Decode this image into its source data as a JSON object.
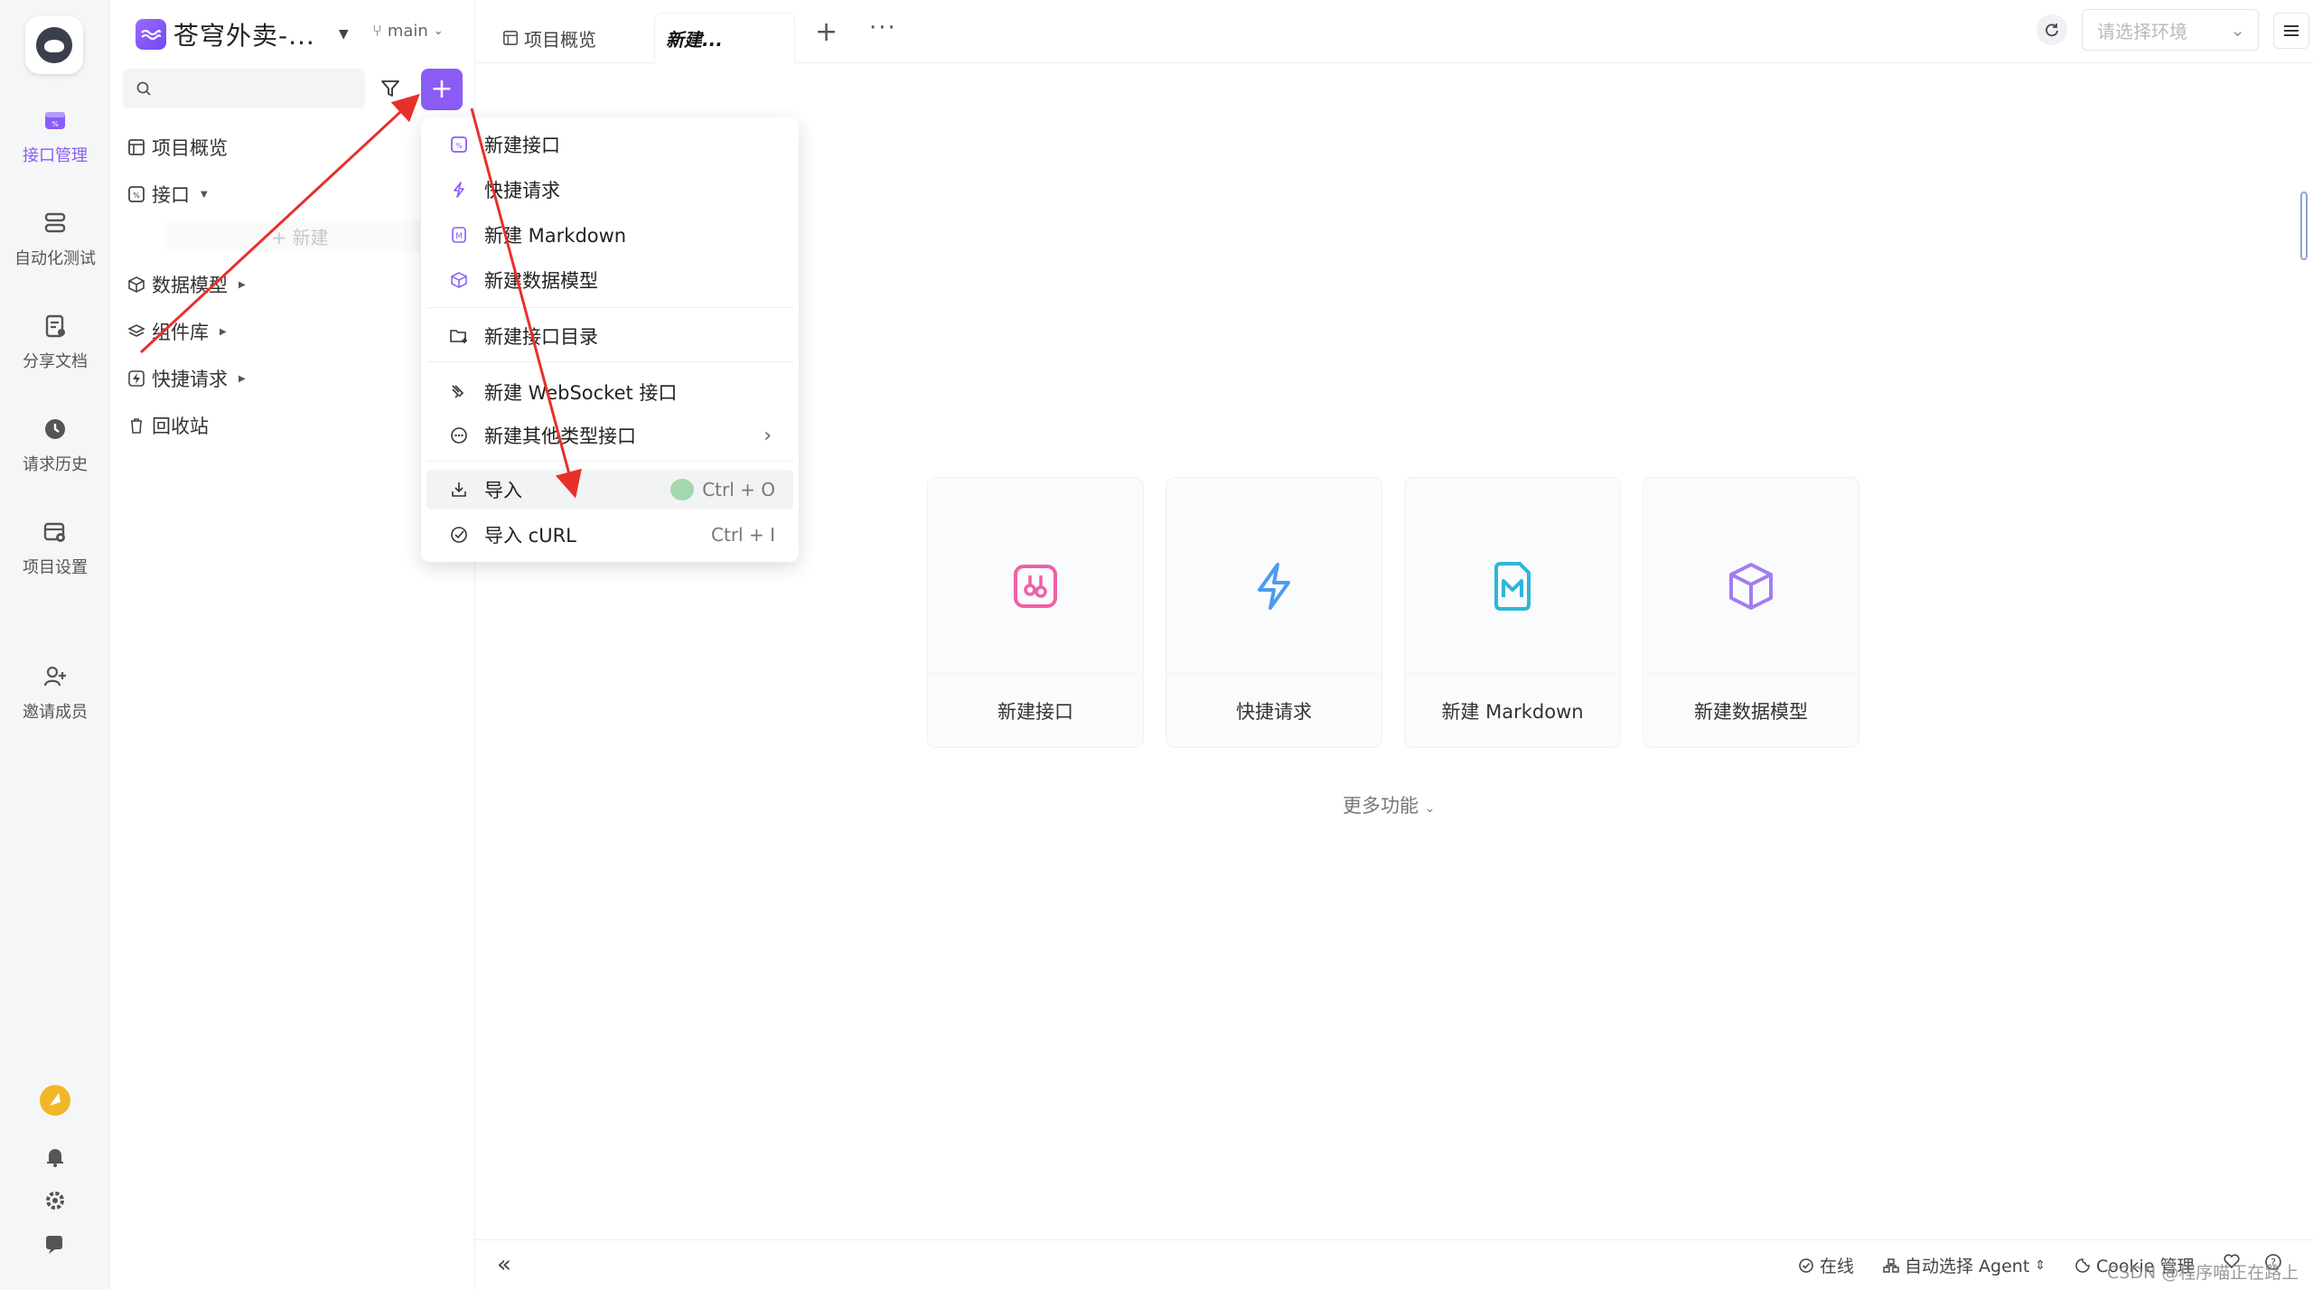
{
  "rail": {
    "items": [
      {
        "label": "接口管理",
        "icon": "api-icon",
        "active": true
      },
      {
        "label": "自动化测试",
        "icon": "automation-icon"
      },
      {
        "label": "分享文档",
        "icon": "share-doc-icon"
      },
      {
        "label": "请求历史",
        "icon": "history-icon"
      },
      {
        "label": "项目设置",
        "icon": "project-settings-icon"
      },
      {
        "label": "邀请成员",
        "icon": "invite-member-icon"
      }
    ]
  },
  "project": {
    "name": "苍穹外卖-...",
    "branch": "main"
  },
  "sidebar": {
    "search_placeholder": "",
    "tree": [
      {
        "label": "项目概览"
      },
      {
        "label": "接口"
      },
      {
        "label": "数据模型"
      },
      {
        "label": "组件库"
      },
      {
        "label": "快捷请求"
      },
      {
        "label": "回收站"
      }
    ],
    "new_placeholder": "+ 新建"
  },
  "tabs": {
    "overview": "项目概览",
    "new": "新建..."
  },
  "env": {
    "placeholder": "请选择环境"
  },
  "menu": {
    "items": [
      {
        "label": "新建接口"
      },
      {
        "label": "快捷请求"
      },
      {
        "label": "新建 Markdown"
      },
      {
        "label": "新建数据模型"
      },
      {
        "label": "新建接口目录"
      },
      {
        "label": "新建 WebSocket 接口"
      },
      {
        "label": "新建其他类型接口"
      },
      {
        "label": "导入",
        "shortcut": "Ctrl + O"
      },
      {
        "label": "导入 cURL",
        "shortcut": "Ctrl + I"
      }
    ]
  },
  "cards": [
    {
      "label": "新建接口",
      "color": "#f05fa8"
    },
    {
      "label": "快捷请求",
      "color": "#4c9cf0"
    },
    {
      "label": "新建 Markdown",
      "color": "#2fb6d8"
    },
    {
      "label": "新建数据模型",
      "color": "#a27df0"
    }
  ],
  "more": "更多功能",
  "bottom": {
    "online": "在线",
    "agent": "自动选择 Agent",
    "cookie": "Cookie 管理"
  },
  "watermark": "CSDN @程序喵正在路上",
  "colors": {
    "accent": "#8a5cf5",
    "annotation": "#e8302a"
  }
}
